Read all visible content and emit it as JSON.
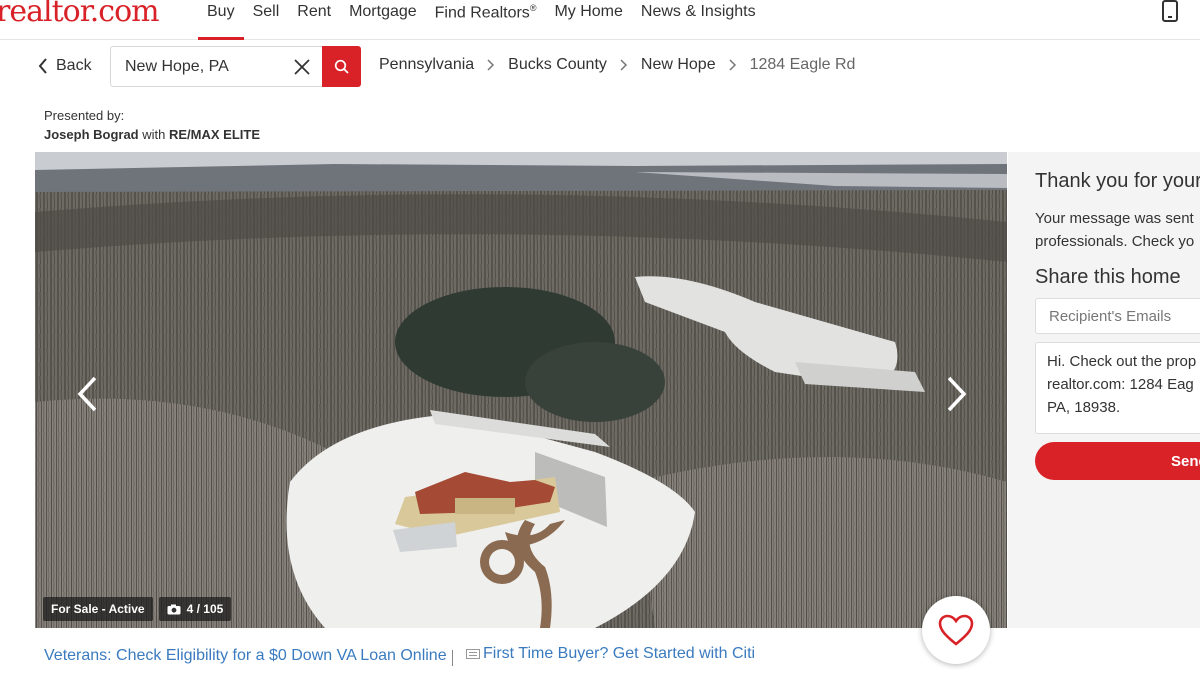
{
  "brand": {
    "logo_text": "realtor.com"
  },
  "nav": {
    "items": [
      {
        "label": "Buy",
        "active": true
      },
      {
        "label": "Sell"
      },
      {
        "label": "Rent"
      },
      {
        "label": "Mortgage"
      },
      {
        "label": "Find Realtors",
        "mark": "®"
      },
      {
        "label": "My Home"
      },
      {
        "label": "News & Insights"
      }
    ]
  },
  "toolbar": {
    "back_label": "Back",
    "search_value": "New Hope, PA"
  },
  "breadcrumb": [
    "Pennsylvania",
    "Bucks County",
    "New Hope",
    "1284 Eagle Rd"
  ],
  "presented": {
    "label": "Presented by:",
    "agent": "Joseph Bograd",
    "with_text": "with",
    "broker": "RE/MAX ELITE"
  },
  "photo": {
    "status": "For Sale - Active",
    "counter": "4 / 105"
  },
  "promos": {
    "va_loan": "Veterans: Check Eligibility for a $0 Down VA Loan Online",
    "citi": "First Time Buyer? Get Started with Citi"
  },
  "sidebar": {
    "thanks_title": "Thank you for your",
    "msg_line1": "Your message was sent",
    "msg_line2": "professionals. Check yo",
    "share_title": "Share this home",
    "email_placeholder": "Recipient's Emails",
    "message_text": "Hi. Check out the prop\nrealtor.com: 1284 Eag\nPA, 18938.",
    "send_label": "Send"
  },
  "colors": {
    "brand_red": "#d92228",
    "link_blue": "#3a7bbf"
  },
  "icons": [
    "chevron-left-icon",
    "close-icon",
    "search-icon",
    "chevron-right-icon",
    "camera-icon",
    "heart-icon",
    "mobile-phone-icon"
  ]
}
